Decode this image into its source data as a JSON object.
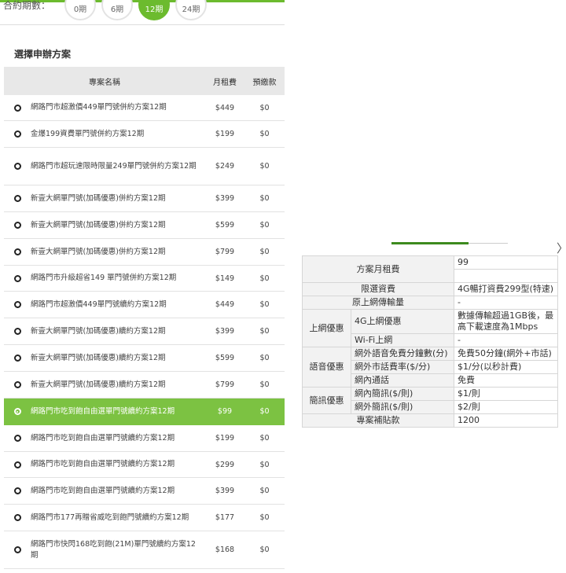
{
  "contract_period": {
    "label": "合約期數：",
    "options": [
      "0期",
      "6期",
      "12期",
      "24期"
    ],
    "selected": "12期"
  },
  "plan_section": {
    "title": "選擇申辦方案",
    "headers": {
      "name": "專案名稱",
      "monthly_fee": "月租費",
      "prepayment": "預繳款"
    },
    "rows": [
      {
        "name": "網路門市超激價449單門號併約方案12期",
        "fee": "$449",
        "prepay": "$0"
      },
      {
        "name": "金爆199資費單門號併約方案12期",
        "fee": "$199",
        "prepay": "$0"
      },
      {
        "name": "網路門市超玩速限時限量249單門號併約方案12期",
        "fee": "$249",
        "prepay": "$0"
      },
      {
        "name": "新壹大網單門號(加碼優惠)併約方案12期",
        "fee": "$399",
        "prepay": "$0"
      },
      {
        "name": "新壹大網單門號(加碼優惠)併約方案12期",
        "fee": "$599",
        "prepay": "$0"
      },
      {
        "name": "新壹大網單門號(加碼優惠)併約方案12期",
        "fee": "$799",
        "prepay": "$0"
      },
      {
        "name": "網路門市升級超省149 單門號併約方案12期",
        "fee": "$149",
        "prepay": "$0"
      },
      {
        "name": "網路門市超激價449單門號續約方案12期",
        "fee": "$449",
        "prepay": "$0"
      },
      {
        "name": "新壹大網單門號(加碼優惠)續約方案12期",
        "fee": "$399",
        "prepay": "$0"
      },
      {
        "name": "新壹大網單門號(加碼優惠)續約方案12期",
        "fee": "$599",
        "prepay": "$0"
      },
      {
        "name": "新壹大網單門號(加碼優惠)續約方案12期",
        "fee": "$799",
        "prepay": "$0"
      },
      {
        "name": "網路門市吃到飽自由選單門號續約方案12期",
        "fee": "$99",
        "prepay": "$0"
      },
      {
        "name": "網路門市吃到飽自由選單門號續約方案12期",
        "fee": "$199",
        "prepay": "$0"
      },
      {
        "name": "網路門市吃到飽自由選單門號續約方案12期",
        "fee": "$299",
        "prepay": "$0"
      },
      {
        "name": "網路門市吃到飽自由選單門號續約方案12期",
        "fee": "$399",
        "prepay": "$0"
      },
      {
        "name": "網路門市177再贈省威吃到飽門號續約方案12期",
        "fee": "$177",
        "prepay": "$0"
      },
      {
        "name": "網路門市快閃168吃到飽(21M)單門號續約方案12期",
        "fee": "$168",
        "prepay": "$0"
      }
    ],
    "selected_index": 11
  },
  "plan_details": {
    "monthly_fee_label": "方案月租費",
    "monthly_fee_value": "99",
    "limited_plan_label": "限選資費",
    "limited_plan_value": "4G暢打資費299型(特速)",
    "bandwidth_label": "原上網傳輸量",
    "bandwidth_value": "-",
    "internet_group_label": "上網優惠",
    "internet_4g_label": "4G上網優惠",
    "internet_4g_value": "數據傳輸超過1GB後，最高下載速度為1Mbps",
    "wifi_label": "Wi-Fi上網",
    "wifi_value": "-",
    "voice_group_label": "語音優惠",
    "offnet_free_label": "網外語音免費分鐘數(分)",
    "offnet_free_value": "免費50分鐘(網外+市話)",
    "offnet_rate_label": "網外市話費率($/分)",
    "offnet_rate_value": "$1/分(以秒計費)",
    "onnet_call_label": "網內通話",
    "onnet_call_value": "免費",
    "sms_group_label": "簡訊優惠",
    "onnet_sms_label": "網內簡訊($/則)",
    "onnet_sms_value": "$1/則",
    "offnet_sms_label": "網外簡訊($/則)",
    "offnet_sms_value": "$2/則",
    "subsidy_label": "專案補貼款",
    "subsidy_value": "1200"
  },
  "carousel": {
    "next_icon": "chevron-right-icon",
    "next_glyph": "〉"
  },
  "colors": {
    "accent": "#7cc242",
    "accent_dark": "#3d8a1e",
    "header_bg": "#e8e8e8"
  }
}
